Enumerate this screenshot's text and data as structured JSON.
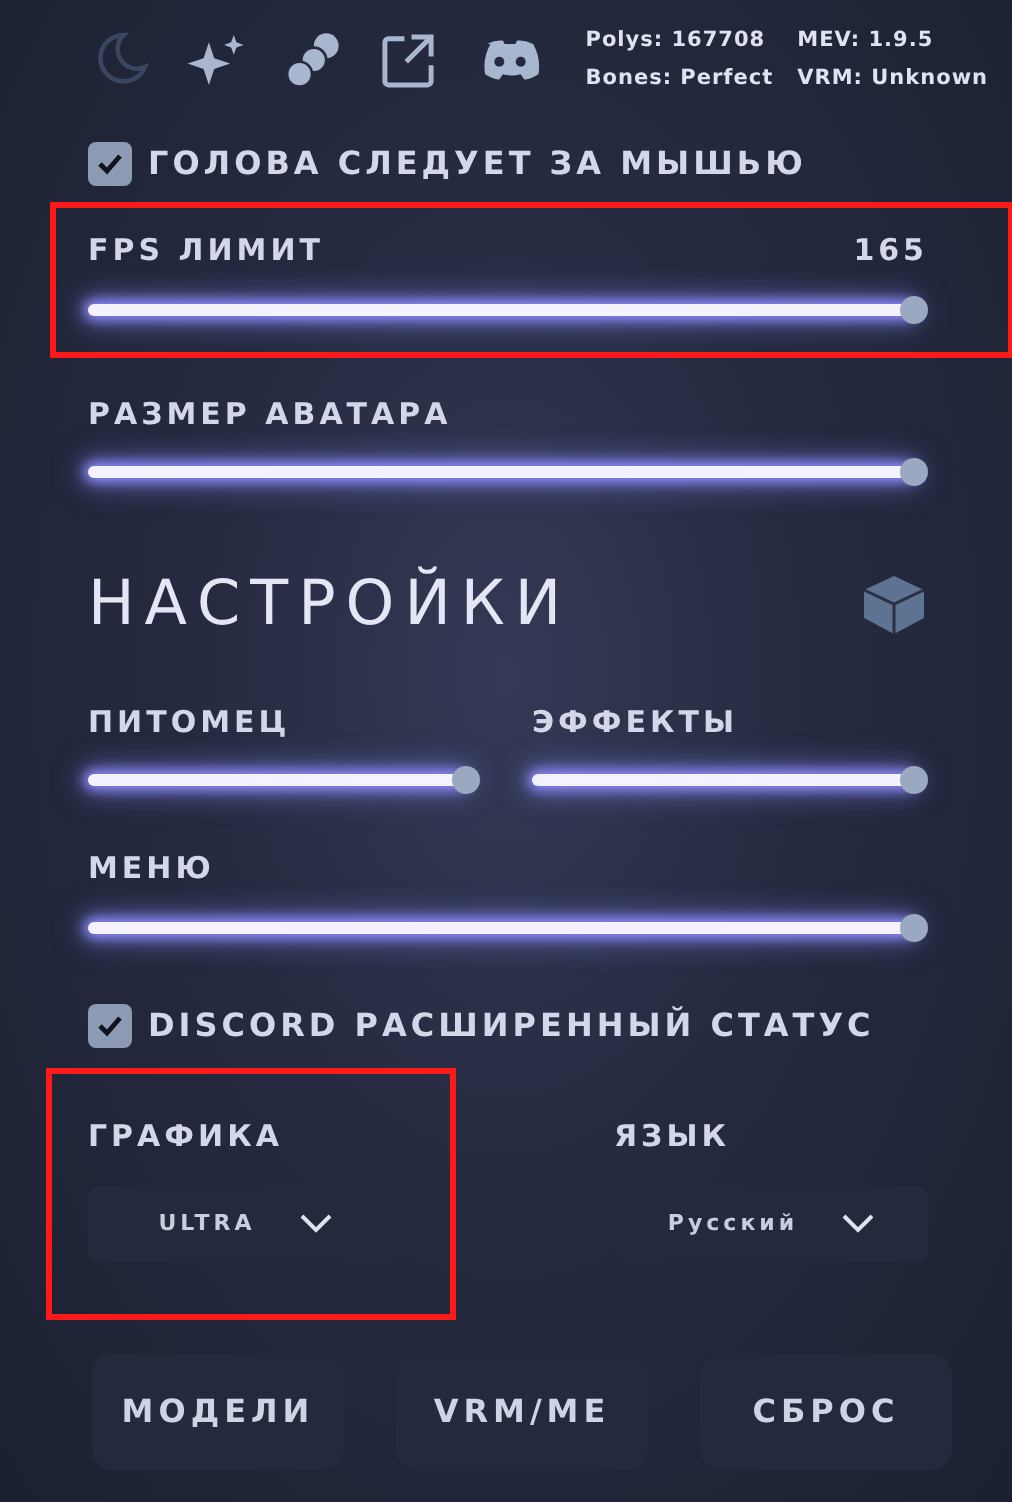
{
  "toolbar": {
    "icons": [
      {
        "kind": "moon",
        "disabled": true
      },
      {
        "kind": "sparkle",
        "disabled": false
      },
      {
        "kind": "spheres",
        "disabled": false
      },
      {
        "kind": "external",
        "disabled": false
      },
      {
        "kind": "controller",
        "disabled": false
      }
    ],
    "stats": [
      "Polys: 167708",
      "MEV: 1.9.5",
      "Bones: Perfect",
      "VRM: Unknown"
    ]
  },
  "head_follow": {
    "label": "ГОЛОВА СЛЕДУЕТ ЗА МЫШЬЮ",
    "checked": true
  },
  "sliders_top": [
    {
      "label": "FPS ЛИМИТ",
      "reading": "165",
      "level": 1.0,
      "highlighted": true
    },
    {
      "label": "РАЗМЕР АВАТАРА",
      "level": 1.0,
      "highlighted": false
    }
  ],
  "settings": {
    "title": "НАСТРОЙКИ",
    "sliders_pair": [
      {
        "label": "ПИТОМЕЦ",
        "level": 1.0
      },
      {
        "label": "ЭФФЕКТЫ",
        "level": 1.0
      }
    ],
    "slider_menu": {
      "label": "МЕНЮ",
      "level": 1.0
    },
    "discord_status": {
      "label": "DISCORD РАСШИРЕННЫЙ СТАТУС",
      "checked": true
    },
    "selects": [
      {
        "label": "ГРАФИКА",
        "value": "ULTRA",
        "highlighted": true
      },
      {
        "label": "ЯЗЫК",
        "value": "Русский",
        "highlighted": false
      }
    ]
  },
  "buttons": [
    "МОДЕЛИ",
    "VRM/ME",
    "СБРОС"
  ]
}
